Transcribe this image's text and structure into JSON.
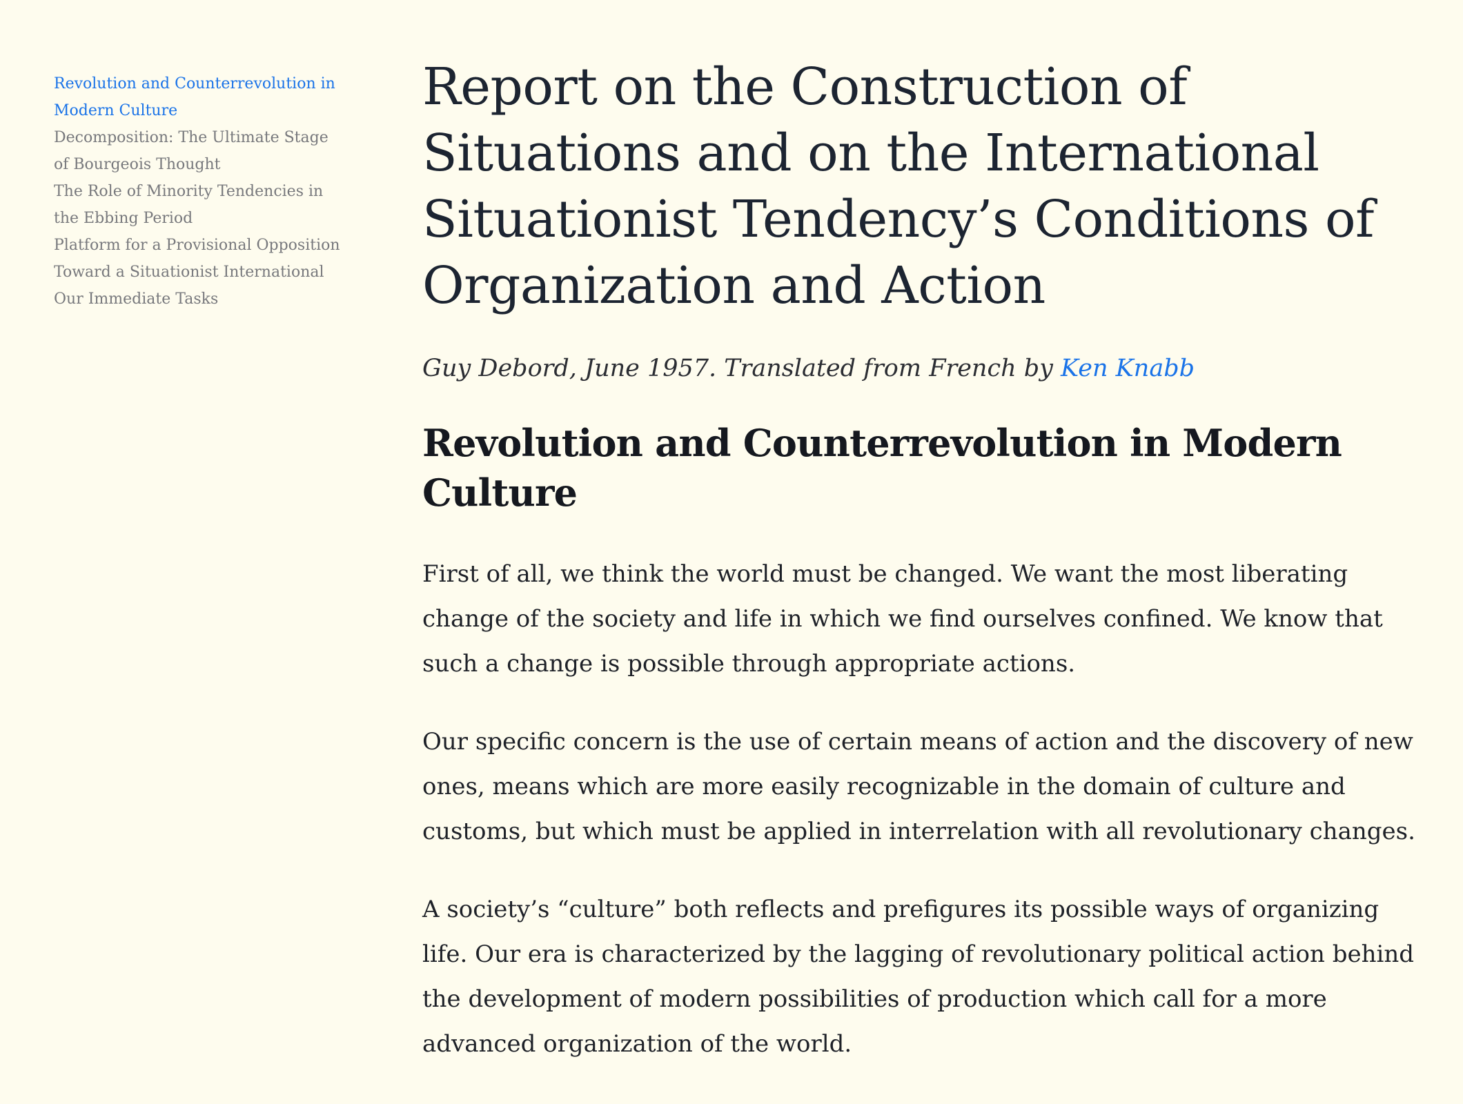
{
  "toc": {
    "items": [
      {
        "label": "Revolution and Counterrevolution in Modern Culture",
        "active": true
      },
      {
        "label": "Decomposition: The Ultimate Stage of Bourgeois Thought",
        "active": false
      },
      {
        "label": "The Role of Minority Tendencies in the Ebbing Period",
        "active": false
      },
      {
        "label": "Platform for a Provisional Opposition",
        "active": false
      },
      {
        "label": "Toward a Situationist International",
        "active": false
      },
      {
        "label": "Our Immediate Tasks",
        "active": false
      }
    ]
  },
  "article": {
    "title": "Report on the Construction of Situations and on the International Situationist Tendency’s Conditions of Organization and Action",
    "byline_text": "Guy Debord, June 1957. Translated from French by ",
    "translator_link": "Ken Knabb",
    "section_heading": "Revolution and Counterrevolution in Modern Culture",
    "paragraphs": [
      "First of all, we think the world must be changed. We want the most liberating change of the society and life in which we find ourselves confined. We know that such a change is possible through appropriate actions.",
      "Our specific concern is the use of certain means of action and the discovery of new ones, means which are more easily recognizable in the domain of culture and customs, but which must be applied in interrelation with all revolutionary changes.",
      "A society’s “culture” both reflects and prefigures its possible ways of organizing life. Our era is characterized by the lagging of revolutionary political action behind the development of modern possibilities of production which call for a more advanced organization of the world."
    ]
  },
  "colors": {
    "background": "#fefcee",
    "link": "#1a73e8",
    "toc_text": "#77787c",
    "heading": "#1c2431"
  }
}
